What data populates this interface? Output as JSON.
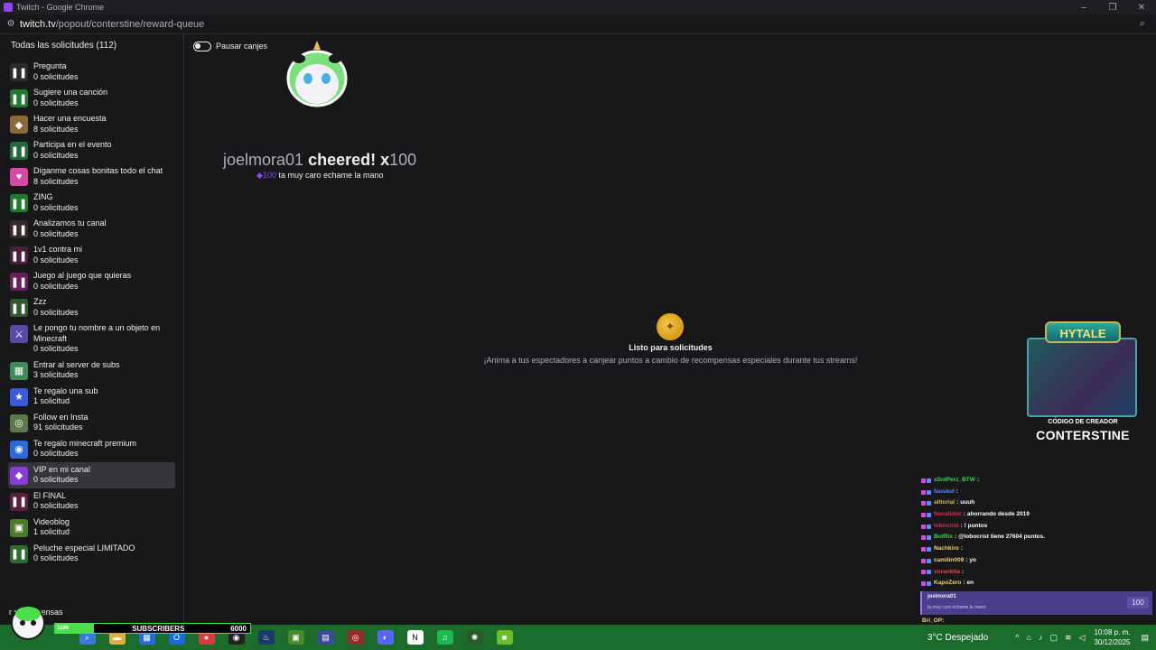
{
  "window": {
    "title": "Twitch - Google Chrome",
    "url_host": "twitch.tv",
    "url_path": "/popout/conterstine/reward-queue"
  },
  "sidebar": {
    "title": "Todas las solicitudes (112)",
    "items": [
      {
        "name": "Pregunta",
        "count": "0 solicitudes",
        "color": "#2b2b2b",
        "glyph": "❚❚"
      },
      {
        "name": "Sugiere una canción",
        "count": "0 solicitudes",
        "color": "#1f7a2e",
        "glyph": "❚❚"
      },
      {
        "name": "Hacer una encuesta",
        "count": "8 solicitudes",
        "color": "#8a6a3a",
        "glyph": "◆"
      },
      {
        "name": "Participa en el evento",
        "count": "0 solicitudes",
        "color": "#1f6b3a",
        "glyph": "❚❚"
      },
      {
        "name": "Díganme cosas bonitas todo el chat",
        "count": "8 solicitudes",
        "color": "#d94aa8",
        "glyph": "♥"
      },
      {
        "name": "ZING",
        "count": "0 solicitudes",
        "color": "#1f7a2e",
        "glyph": "❚❚"
      },
      {
        "name": "Analizamos tu canal",
        "count": "0 solicitudes",
        "color": "#3a2b2b",
        "glyph": "❚❚"
      },
      {
        "name": "1v1 contra mi",
        "count": "0 solicitudes",
        "color": "#4a1f3a",
        "glyph": "❚❚"
      },
      {
        "name": "Juego al juego que quieras",
        "count": "0 solicitudes",
        "color": "#6a1f5a",
        "glyph": "❚❚"
      },
      {
        "name": "Zzz",
        "count": "0 solicitudes",
        "color": "#2e5a2e",
        "glyph": "❚❚"
      },
      {
        "name": "Le pongo tu nombre a un objeto en Minecraft",
        "count": "0 solicitudes",
        "color": "#5a4aa8",
        "glyph": "⚔"
      },
      {
        "name": "Entrar al server de subs",
        "count": "3 solicitudes",
        "color": "#3f8a5a",
        "glyph": "▦"
      },
      {
        "name": "Te regalo una sub",
        "count": "1 solicitud",
        "color": "#3a5ad9",
        "glyph": "★"
      },
      {
        "name": "Follow en Insta",
        "count": "91 solicitudes",
        "color": "#5a7a4a",
        "glyph": "◎"
      },
      {
        "name": "Te regalo minecraft premium",
        "count": "0 solicitudes",
        "color": "#2a6ad9",
        "glyph": "◉"
      },
      {
        "name": "VIP en mi canal",
        "count": "0 solicitudes",
        "color": "#8a3ad9",
        "glyph": "◆"
      },
      {
        "name": "El FINAL",
        "count": "0 solicitudes",
        "color": "#5a1f3a",
        "glyph": "❚❚"
      },
      {
        "name": "Videoblog",
        "count": "1 solicitud",
        "color": "#4a7a2a",
        "glyph": "▣"
      },
      {
        "name": "Peluche especial LIMITADO",
        "count": "0 solicitudes",
        "color": "#2e6b2e",
        "glyph": "❚❚"
      }
    ],
    "manage_label": "r recompensas"
  },
  "main": {
    "pause_label": "Pausar canjes",
    "cheer": {
      "user": "joelmora01",
      "word": "cheered!",
      "x": "x",
      "amount": "100",
      "bits": "100",
      "message": "ta muy caro echame la mano"
    },
    "ready_title": "Listo para solicitudes",
    "ready_sub": "¡Anima a tus espectadores a canjear puntos a cambio de recompensas especiales durante tus streams!"
  },
  "promo": {
    "logo": "HYTALE",
    "code_label": "CÓDIGO DE CREADOR",
    "name": "CONTERSTINE"
  },
  "chat": [
    {
      "user": "xSnIPerz_BTW",
      "color": "#3fd24a",
      "msg": ""
    },
    {
      "user": "fauskul",
      "color": "#5a8aff",
      "msg": ""
    },
    {
      "user": "alltorial",
      "color": "#d9b84a",
      "msg": "uuuh"
    },
    {
      "user": "Necalidoc",
      "color": "#d9304a",
      "msg": "ahorrando desde 2019"
    },
    {
      "user": "lobocrist",
      "color": "#d9304a",
      "msg": "! puntos"
    },
    {
      "user": "BotRix",
      "color": "#3fd24a",
      "msg": "@lobocrist tiene 27604 puntos."
    },
    {
      "user": "Nachkiro",
      "color": "#f0d070",
      "msg": ""
    },
    {
      "user": "camilin009",
      "color": "#f0d070",
      "msg": "yo"
    },
    {
      "user": "vorankha",
      "color": "#d94a4a",
      "msg": ""
    },
    {
      "user": "KapoZero",
      "color": "#f0d070",
      "msg": "en"
    }
  ],
  "chat_highlight": {
    "user": "joelmora01",
    "msg": "ta muy caro echame la mano",
    "amount": "100"
  },
  "chat_tail": [
    {
      "user": "Bri_OP",
      "color": "#f0d070",
      "msg": ""
    },
    {
      "user": "Nachkiro",
      "color": "#f0d070",
      "msg": ""
    },
    {
      "user": "camilin009",
      "color": "#f0d070",
      "msg": "yo"
    }
  ],
  "overlay": {
    "sub_current": "1196",
    "sub_label": "SUBSCRIBERS",
    "sub_goal": "6000",
    "sub_progress": 0.2
  },
  "tray": {
    "weather": "3°C  Despejado",
    "time": "10:08 p. m.",
    "date": "30/12/2025",
    "notif_count": "3"
  }
}
